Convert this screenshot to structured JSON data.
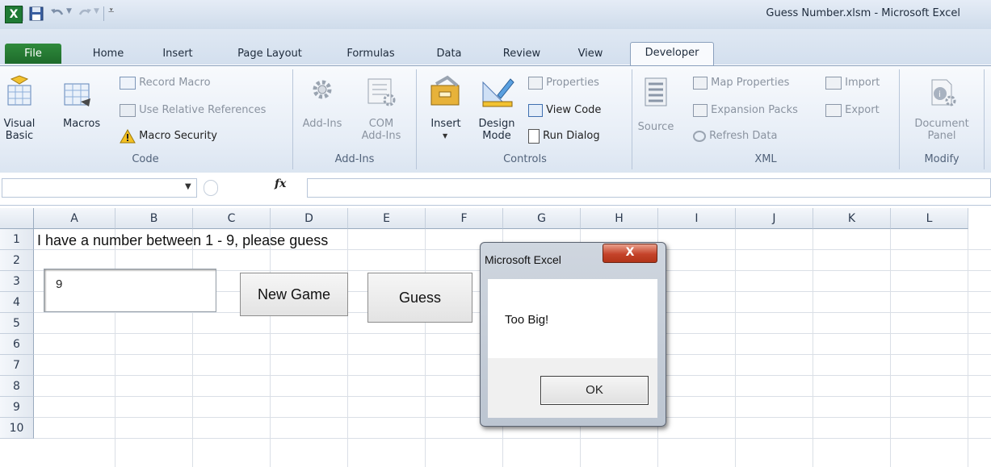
{
  "window": {
    "title": "Guess Number.xlsm  -  Microsoft Excel"
  },
  "quick_access": {
    "icons": [
      "excel-logo-icon",
      "save-icon",
      "undo-icon",
      "redo-icon",
      "customize-icon"
    ]
  },
  "tabs": {
    "file": "File",
    "home": "Home",
    "insert": "Insert",
    "page_layout": "Page Layout",
    "formulas": "Formulas",
    "data": "Data",
    "review": "Review",
    "view": "View",
    "developer": "Developer"
  },
  "ribbon": {
    "code": {
      "visual_basic_1": "Visual",
      "visual_basic_2": "Basic",
      "macros": "Macros",
      "record_macro": "Record Macro",
      "use_relative": "Use Relative References",
      "macro_security": "Macro Security",
      "label": "Code"
    },
    "addins": {
      "addins": "Add-Ins",
      "com_1": "COM",
      "com_2": "Add-Ins",
      "label": "Add-Ins"
    },
    "controls": {
      "insert": "Insert",
      "design_1": "Design",
      "design_2": "Mode",
      "properties": "Properties",
      "view_code": "View Code",
      "run_dialog": "Run Dialog",
      "label": "Controls"
    },
    "xml": {
      "source": "Source",
      "map_properties": "Map Properties",
      "expansion_packs": "Expansion Packs",
      "refresh_data": "Refresh Data",
      "import": "Import",
      "export": "Export",
      "label": "XML"
    },
    "modify": {
      "doc_1": "Document",
      "doc_2": "Panel",
      "label": "Modify"
    }
  },
  "formula_bar": {
    "fx": "fx",
    "name_box": "",
    "formula": ""
  },
  "sheet": {
    "columns": [
      "A",
      "B",
      "C",
      "D",
      "E",
      "F",
      "G",
      "H",
      "I",
      "J",
      "K",
      "L"
    ],
    "rows": [
      "1",
      "2",
      "3",
      "4",
      "5",
      "6",
      "7",
      "8",
      "9",
      "10"
    ],
    "a1": "I have a number between 1 - 9, please guess",
    "textbox_value": "9",
    "new_game": "New Game",
    "guess": "Guess"
  },
  "dialog": {
    "title": "Microsoft Excel",
    "close": "X",
    "message": "Too Big!",
    "ok": "OK"
  }
}
